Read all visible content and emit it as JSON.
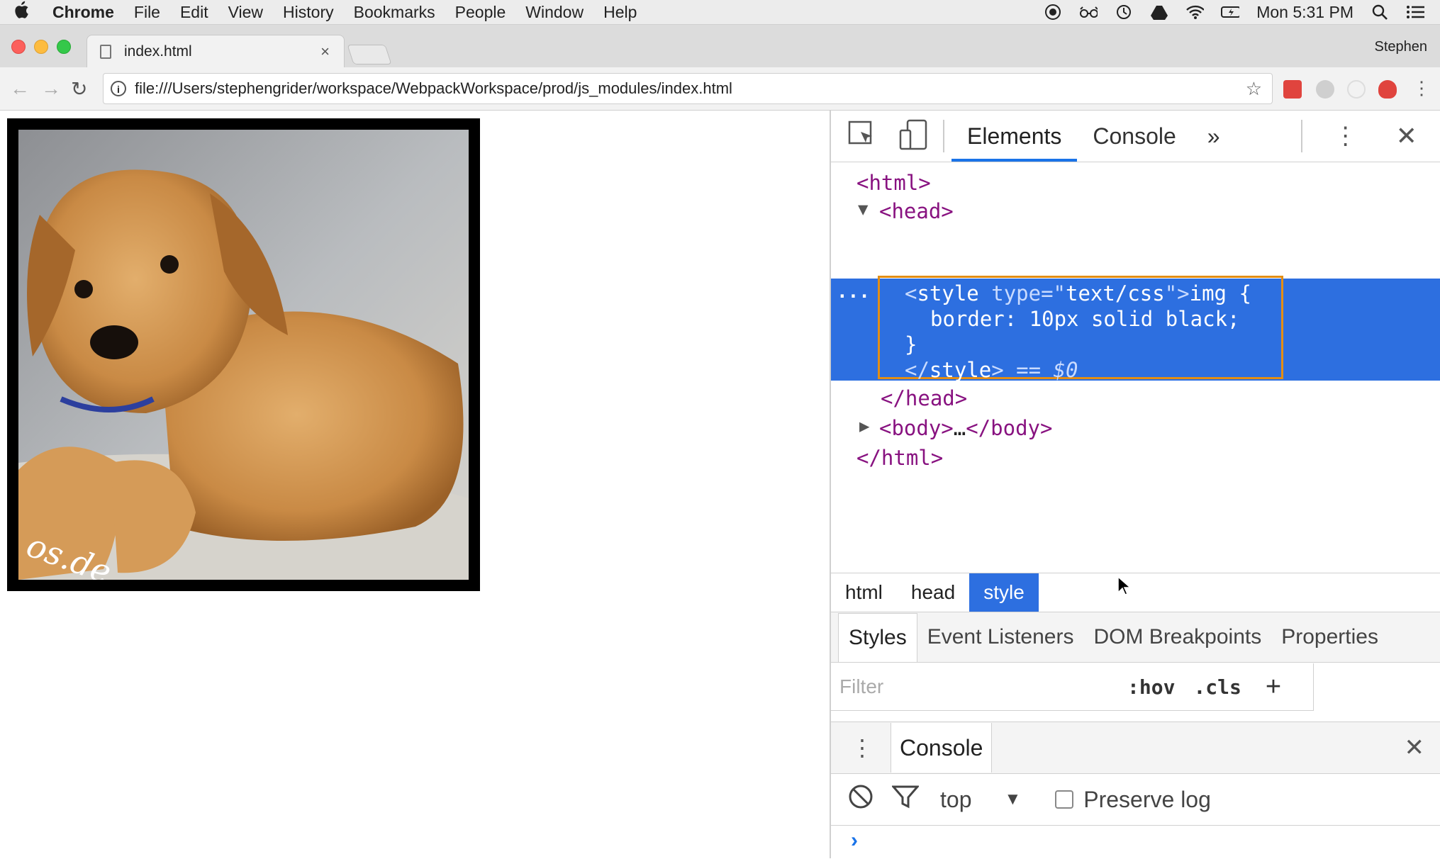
{
  "menubar": {
    "app": "Chrome",
    "items": [
      "File",
      "Edit",
      "View",
      "History",
      "Bookmarks",
      "People",
      "Window",
      "Help"
    ],
    "clock": "Mon 5:31 PM"
  },
  "browser": {
    "tab_title": "index.html",
    "tab_close": "×",
    "profile": "Stephen",
    "url": "file:///Users/stephengrider/workspace/WebpackWorkspace/prod/js_modules/index.html"
  },
  "devtools": {
    "tabs": {
      "elements": "Elements",
      "console": "Console",
      "more": "»"
    },
    "dom": {
      "html_open": "<html>",
      "head_open": "<head>",
      "style_open_lt": "<",
      "style_tag": "style",
      "style_attr": "type",
      "style_eq": "=\"",
      "style_val": "text/css",
      "style_close_quote": "\">",
      "style_text1": "img {",
      "style_text2": "border: 10px solid black;",
      "style_text3": "}",
      "style_close_lt": "</",
      "style_close_tag": "style",
      "style_close_gt": ">",
      "selected_marker": " == $0",
      "ellipsis": "...",
      "head_close": "</head>",
      "body_open": "<body>",
      "body_ellipsis": "…",
      "body_close": "</body>",
      "html_close": "</html>"
    },
    "breadcrumbs": [
      "html",
      "head",
      "style"
    ],
    "styles_tabs": [
      "Styles",
      "Event Listeners",
      "DOM Breakpoints",
      "Properties"
    ],
    "filter_placeholder": "Filter",
    "hov": ":hov",
    "cls": ".cls",
    "plus": "+",
    "drawer": {
      "tab": "Console",
      "context": "top",
      "preserve_log": "Preserve log"
    }
  }
}
